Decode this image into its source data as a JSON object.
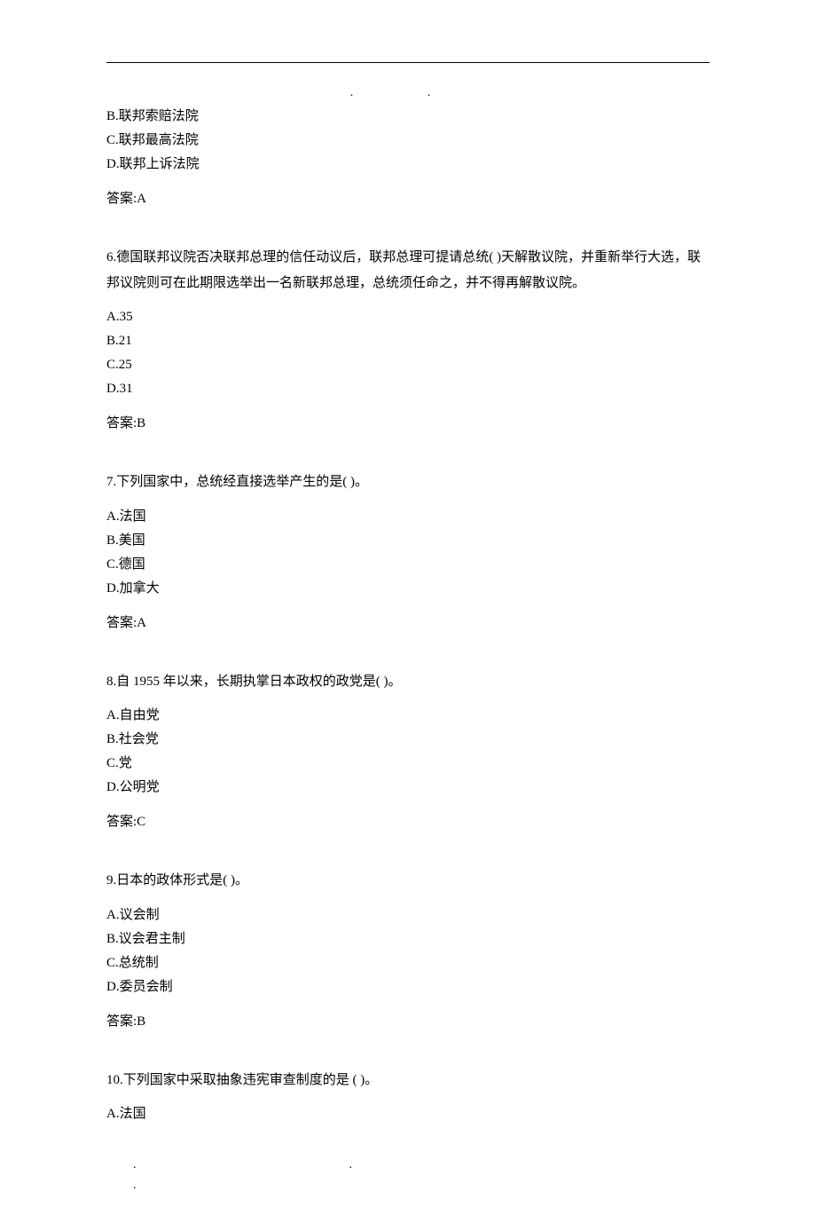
{
  "header_dots": ".          .",
  "q5_optB": "B.联邦索赔法院",
  "q5_optC": "C.联邦最高法院",
  "q5_optD": "D.联邦上诉法院",
  "q5_answer": "答案:A",
  "q6_text": "6.德国联邦议院否决联邦总理的信任动议后，联邦总理可提请总统( )天解散议院，并重新举行大选，联邦议院则可在此期限选举出一名新联邦总理，总统须任命之，并不得再解散议院。",
  "q6_optA": "A.35",
  "q6_optB": "B.21",
  "q6_optC": "C.25",
  "q6_optD": "D.31",
  "q6_answer": "答案:B",
  "q7_text": "7.下列国家中，总统经直接选举产生的是(   )。",
  "q7_optA": "A.法国",
  "q7_optB": "B.美国",
  "q7_optC": "C.德国",
  "q7_optD": "D.加拿大",
  "q7_answer": "答案:A",
  "q8_text": "8.自 1955 年以来，长期执掌日本政权的政党是(   )。",
  "q8_optA": "A.自由党",
  "q8_optB": "B.社会党",
  "q8_optC": "C.党",
  "q8_optD": "D.公明党",
  "q8_answer": "答案:C",
  "q9_text": "9.日本的政体形式是(   )。",
  "q9_optA": "A.议会制",
  "q9_optB": "B.议会君主制",
  "q9_optC": "C.总统制",
  "q9_optD": "D.委员会制",
  "q9_answer": "答案:B",
  "q10_text": "10.下列国家中采取抽象违宪审查制度的是 ( )。",
  "q10_optA": "A.法国",
  "footer_dots": "...."
}
